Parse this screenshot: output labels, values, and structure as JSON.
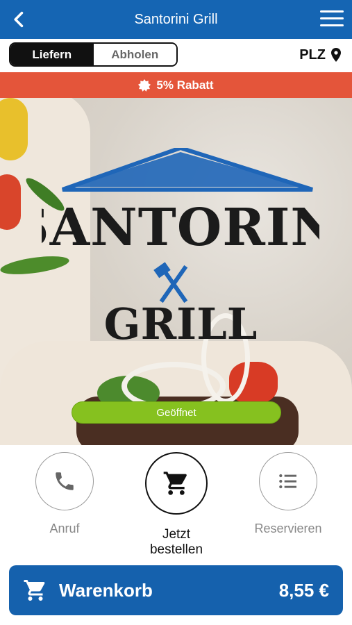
{
  "header": {
    "title": "Santorini Grill",
    "back_icon": "chevron-left-icon",
    "menu_icon": "hamburger-menu-icon"
  },
  "mode": {
    "options": [
      "Liefern",
      "Abholen"
    ],
    "selected": "Liefern"
  },
  "plz": {
    "label": "PLZ",
    "icon": "map-pin-icon"
  },
  "banner": {
    "text": "5% Rabatt",
    "icon": "badge-star-icon",
    "color": "#e4553a"
  },
  "hero": {
    "logo_title": "SANTORINI",
    "logo_subtitle": "GRILL",
    "status": "Geöffnet",
    "status_color": "#86c11f"
  },
  "actions": [
    {
      "label": "Anruf",
      "icon": "phone-icon"
    },
    {
      "label": "Jetzt bestellen",
      "icon": "cart-icon"
    },
    {
      "label": "Reservieren",
      "icon": "list-icon"
    }
  ],
  "cart": {
    "label": "Warenkorb",
    "total": "8,55 €",
    "icon": "cart-icon"
  },
  "colors": {
    "brand": "#1565b3",
    "cart_bg": "#1561ad"
  }
}
